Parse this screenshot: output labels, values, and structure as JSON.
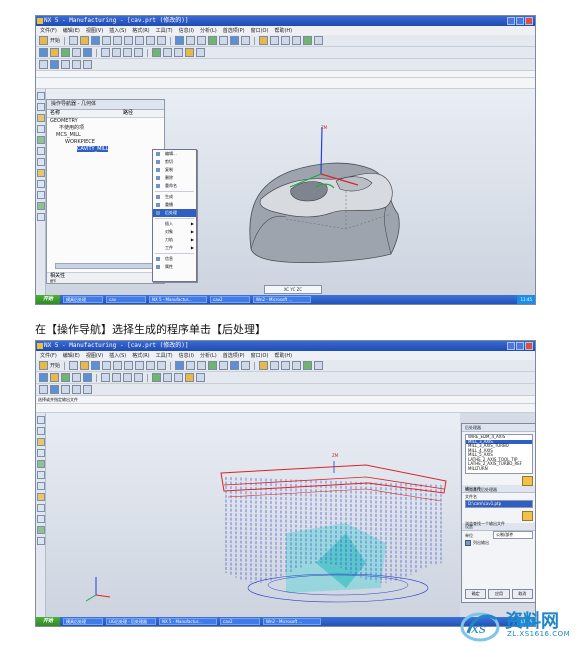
{
  "caption": "在【操作导航】选择生成的程序单击【后处理】",
  "screenshot1": {
    "window_title": "NX 5 - Manufacturing - [cav.prt (修改的)]",
    "menu": [
      "文件(F)",
      "编辑(E)",
      "视图(V)",
      "插入(S)",
      "格式(R)",
      "工具(T)",
      "信息(I)",
      "分析(L)",
      "首选项(P)",
      "窗口(O)",
      "帮助(H)"
    ],
    "toolbar_start_label": "开始",
    "nav_panel": {
      "title": "操作导航器 - 几何体",
      "col_name": "名称",
      "col_path": "路径",
      "rows": [
        "GEOMETRY",
        "不使用的项",
        "MCS_MILL",
        "WORKPIECE",
        "CAVITY_MILL"
      ],
      "footer_detail": "相关性",
      "footer_detail2": "细节"
    },
    "context_menu": {
      "items": [
        {
          "label": "编辑...",
          "submenu": false
        },
        {
          "label": "剪切",
          "submenu": false
        },
        {
          "label": "复制",
          "submenu": false
        },
        {
          "label": "删除",
          "submenu": false
        },
        {
          "label": "重命名",
          "submenu": false
        },
        {
          "label": "生成",
          "submenu": false
        },
        {
          "label": "重播",
          "submenu": false
        },
        {
          "label": "后处理",
          "submenu": false
        },
        {
          "label": "插入",
          "submenu": true
        },
        {
          "label": "对象",
          "submenu": true
        },
        {
          "label": "刀轨",
          "submenu": true
        },
        {
          "label": "工件",
          "submenu": true
        },
        {
          "label": "信息",
          "submenu": false
        },
        {
          "label": "属性",
          "submenu": false
        }
      ],
      "highlighted": "后处理"
    },
    "status_box": "XC YC ZC",
    "axis_label": "ZM",
    "taskbar": {
      "start": "开始",
      "tasks": [
        "模具后处理",
        "cav",
        "NX 5 - Manufactur...",
        "cav2",
        "Wn2 - Microsoft ..."
      ],
      "tray_time": "11:45"
    }
  },
  "screenshot2": {
    "window_title": "NX 5 - Manufacturing - [cav.prt (修改的)]",
    "menu": [
      "文件(F)",
      "编辑(E)",
      "视图(V)",
      "插入(S)",
      "格式(R)",
      "工具(T)",
      "信息(I)",
      "分析(L)",
      "首选项(P)",
      "窗口(O)",
      "帮助(H)"
    ],
    "toolbar_start_label": "开始",
    "prompt": "选择或并指定输出文件",
    "axis_label": "ZM",
    "post_dialog": {
      "section_post": "后处理器",
      "postprocessors": [
        "WIRE_EDM_4_AXIS",
        "MILL_3_AXIS",
        "MILL_3_AXIS_TURBO",
        "MILL_4_AXIS",
        "MILL_5_AXIS",
        "LATHE_2_AXIS_TOOL_TIP",
        "LATHE_2_AXIS_TURBO_REF",
        "MILLTURN"
      ],
      "selected_post": "MILL_3_AXIS",
      "browse_post": "浏览查找后处理器",
      "section_output": "输出文件",
      "filename_label": "文件名",
      "filename_value": "D:\\cam\\cav1.ptp",
      "browse_output": "浏览查找一个输出文件",
      "section_settings": "设置",
      "unit_label": "单位",
      "unit_value": "公制/部件",
      "list_output_label": "列出输出",
      "buttons": [
        "确定",
        "应用",
        "取消"
      ]
    },
    "taskbar": {
      "start": "开始",
      "tasks": [
        "模具后处理",
        "UG后处理 - 后处理器",
        "NX 5 - Manufactur...",
        "cav2",
        "Wn2 - Microsoft ..."
      ],
      "tray_time": "11:46"
    }
  },
  "watermark": {
    "brand": "资料网",
    "url": "ZL.XS1616.COM"
  }
}
